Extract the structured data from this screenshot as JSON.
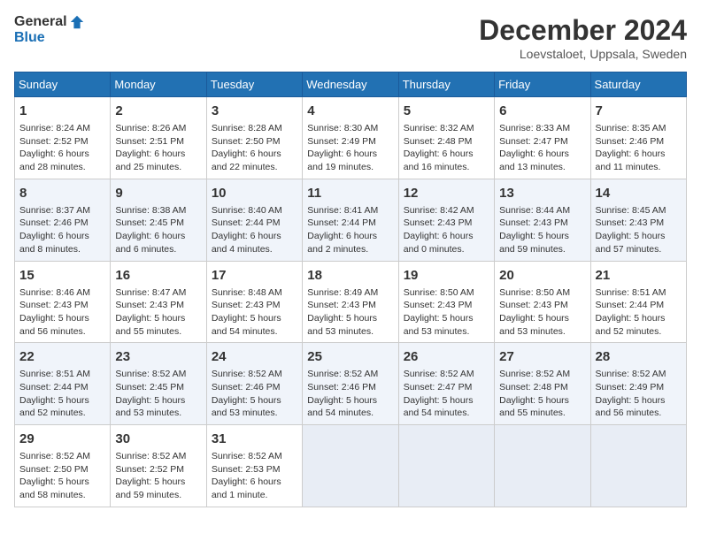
{
  "header": {
    "logo_general": "General",
    "logo_blue": "Blue",
    "month_year": "December 2024",
    "location": "Loevstaloet, Uppsala, Sweden"
  },
  "weekdays": [
    "Sunday",
    "Monday",
    "Tuesday",
    "Wednesday",
    "Thursday",
    "Friday",
    "Saturday"
  ],
  "weeks": [
    [
      {
        "day": "1",
        "sunrise": "8:24 AM",
        "sunset": "2:52 PM",
        "daylight": "6 hours and 28 minutes."
      },
      {
        "day": "2",
        "sunrise": "8:26 AM",
        "sunset": "2:51 PM",
        "daylight": "6 hours and 25 minutes."
      },
      {
        "day": "3",
        "sunrise": "8:28 AM",
        "sunset": "2:50 PM",
        "daylight": "6 hours and 22 minutes."
      },
      {
        "day": "4",
        "sunrise": "8:30 AM",
        "sunset": "2:49 PM",
        "daylight": "6 hours and 19 minutes."
      },
      {
        "day": "5",
        "sunrise": "8:32 AM",
        "sunset": "2:48 PM",
        "daylight": "6 hours and 16 minutes."
      },
      {
        "day": "6",
        "sunrise": "8:33 AM",
        "sunset": "2:47 PM",
        "daylight": "6 hours and 13 minutes."
      },
      {
        "day": "7",
        "sunrise": "8:35 AM",
        "sunset": "2:46 PM",
        "daylight": "6 hours and 11 minutes."
      }
    ],
    [
      {
        "day": "8",
        "sunrise": "8:37 AM",
        "sunset": "2:46 PM",
        "daylight": "6 hours and 8 minutes."
      },
      {
        "day": "9",
        "sunrise": "8:38 AM",
        "sunset": "2:45 PM",
        "daylight": "6 hours and 6 minutes."
      },
      {
        "day": "10",
        "sunrise": "8:40 AM",
        "sunset": "2:44 PM",
        "daylight": "6 hours and 4 minutes."
      },
      {
        "day": "11",
        "sunrise": "8:41 AM",
        "sunset": "2:44 PM",
        "daylight": "6 hours and 2 minutes."
      },
      {
        "day": "12",
        "sunrise": "8:42 AM",
        "sunset": "2:43 PM",
        "daylight": "6 hours and 0 minutes."
      },
      {
        "day": "13",
        "sunrise": "8:44 AM",
        "sunset": "2:43 PM",
        "daylight": "5 hours and 59 minutes."
      },
      {
        "day": "14",
        "sunrise": "8:45 AM",
        "sunset": "2:43 PM",
        "daylight": "5 hours and 57 minutes."
      }
    ],
    [
      {
        "day": "15",
        "sunrise": "8:46 AM",
        "sunset": "2:43 PM",
        "daylight": "5 hours and 56 minutes."
      },
      {
        "day": "16",
        "sunrise": "8:47 AM",
        "sunset": "2:43 PM",
        "daylight": "5 hours and 55 minutes."
      },
      {
        "day": "17",
        "sunrise": "8:48 AM",
        "sunset": "2:43 PM",
        "daylight": "5 hours and 54 minutes."
      },
      {
        "day": "18",
        "sunrise": "8:49 AM",
        "sunset": "2:43 PM",
        "daylight": "5 hours and 53 minutes."
      },
      {
        "day": "19",
        "sunrise": "8:50 AM",
        "sunset": "2:43 PM",
        "daylight": "5 hours and 53 minutes."
      },
      {
        "day": "20",
        "sunrise": "8:50 AM",
        "sunset": "2:43 PM",
        "daylight": "5 hours and 53 minutes."
      },
      {
        "day": "21",
        "sunrise": "8:51 AM",
        "sunset": "2:44 PM",
        "daylight": "5 hours and 52 minutes."
      }
    ],
    [
      {
        "day": "22",
        "sunrise": "8:51 AM",
        "sunset": "2:44 PM",
        "daylight": "5 hours and 52 minutes."
      },
      {
        "day": "23",
        "sunrise": "8:52 AM",
        "sunset": "2:45 PM",
        "daylight": "5 hours and 53 minutes."
      },
      {
        "day": "24",
        "sunrise": "8:52 AM",
        "sunset": "2:46 PM",
        "daylight": "5 hours and 53 minutes."
      },
      {
        "day": "25",
        "sunrise": "8:52 AM",
        "sunset": "2:46 PM",
        "daylight": "5 hours and 54 minutes."
      },
      {
        "day": "26",
        "sunrise": "8:52 AM",
        "sunset": "2:47 PM",
        "daylight": "5 hours and 54 minutes."
      },
      {
        "day": "27",
        "sunrise": "8:52 AM",
        "sunset": "2:48 PM",
        "daylight": "5 hours and 55 minutes."
      },
      {
        "day": "28",
        "sunrise": "8:52 AM",
        "sunset": "2:49 PM",
        "daylight": "5 hours and 56 minutes."
      }
    ],
    [
      {
        "day": "29",
        "sunrise": "8:52 AM",
        "sunset": "2:50 PM",
        "daylight": "5 hours and 58 minutes."
      },
      {
        "day": "30",
        "sunrise": "8:52 AM",
        "sunset": "2:52 PM",
        "daylight": "5 hours and 59 minutes."
      },
      {
        "day": "31",
        "sunrise": "8:52 AM",
        "sunset": "2:53 PM",
        "daylight": "6 hours and 1 minute."
      },
      null,
      null,
      null,
      null
    ]
  ]
}
